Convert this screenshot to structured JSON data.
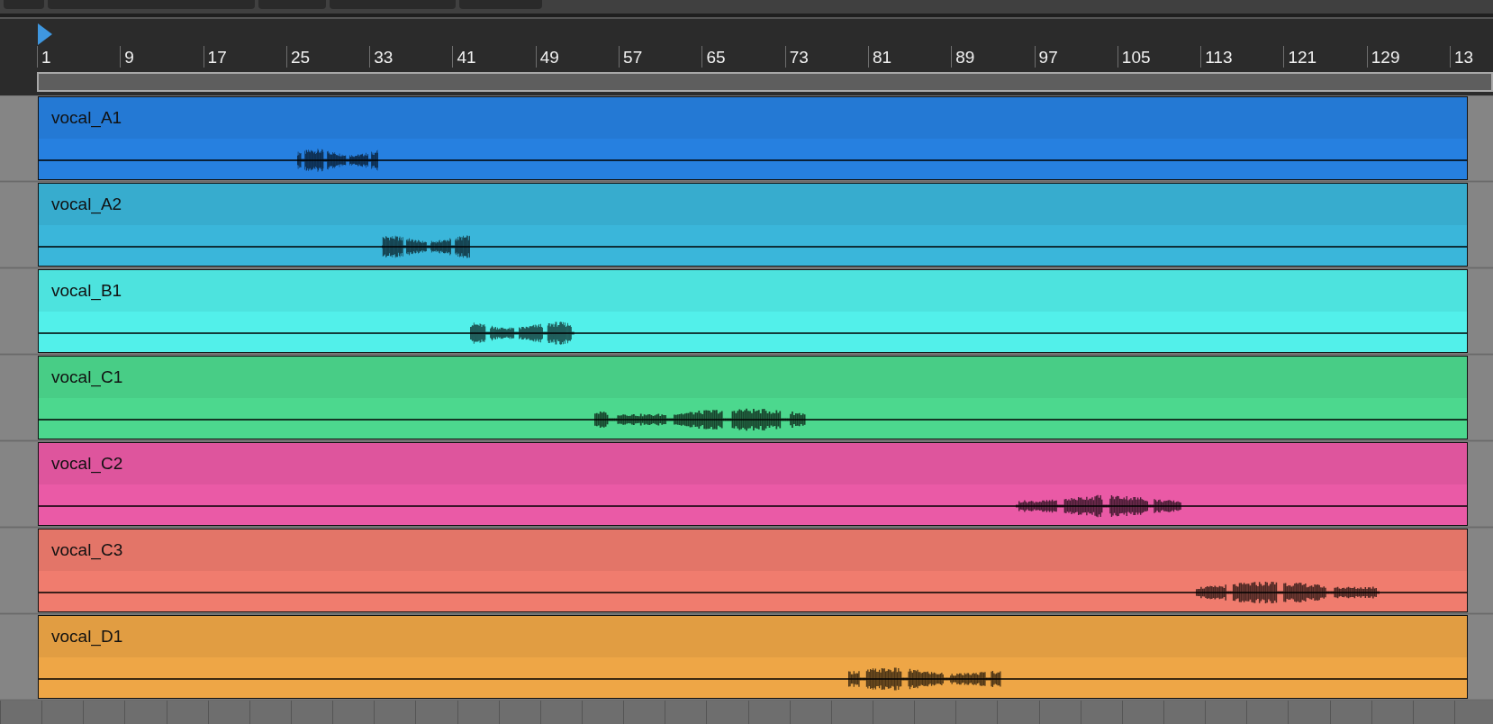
{
  "ruler": {
    "labels": [
      "1",
      "9",
      "17",
      "25",
      "33",
      "41",
      "49",
      "57",
      "65",
      "73",
      "81",
      "89",
      "97",
      "105",
      "113",
      "121",
      "129",
      "13"
    ]
  },
  "clips": [
    {
      "name": "vocal_A1",
      "color": "#2680e0"
    },
    {
      "name": "vocal_A2",
      "color": "#3ab6da"
    },
    {
      "name": "vocal_B1",
      "color": "#52f0ea"
    },
    {
      "name": "vocal_C1",
      "color": "#4cd88e"
    },
    {
      "name": "vocal_C2",
      "color": "#ea5aa6"
    },
    {
      "name": "vocal_C3",
      "color": "#f07c6e"
    },
    {
      "name": "vocal_D1",
      "color": "#eea646"
    }
  ]
}
